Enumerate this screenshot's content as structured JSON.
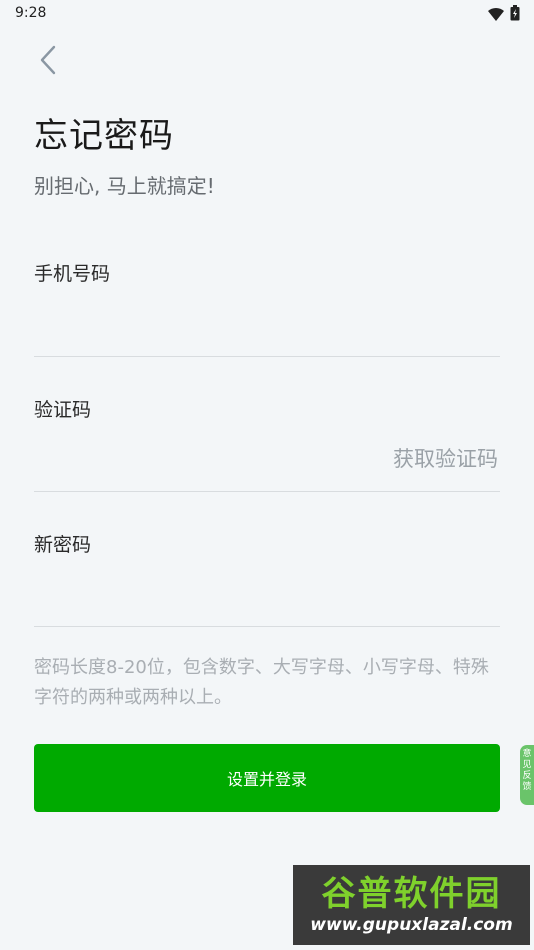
{
  "status_bar": {
    "time": "9:28",
    "icons": [
      "wifi-icon",
      "battery-icon"
    ]
  },
  "nav": {
    "back_icon": "chevron-left-icon"
  },
  "page": {
    "title": "忘记密码",
    "subtitle": "别担心, 马上就搞定!"
  },
  "form": {
    "phone_label": "手机号码",
    "phone_value": "",
    "code_label": "验证码",
    "code_value": "",
    "get_code": "获取验证码",
    "password_label": "新密码",
    "password_value": "",
    "hint": "密码长度8-20位，包含数字、大写字母、小写字母、特殊字符的两种或两种以上。",
    "submit": "设置并登录"
  },
  "feedback_tab": {
    "label": "意见反馈"
  },
  "watermark": {
    "main": "谷普软件园",
    "url": "www.gupuxlazal.com"
  },
  "colors": {
    "background": "#f3f6f8",
    "accent": "#00aa00",
    "divider": "#d8dcdf",
    "muted": "#9aa1a7"
  }
}
